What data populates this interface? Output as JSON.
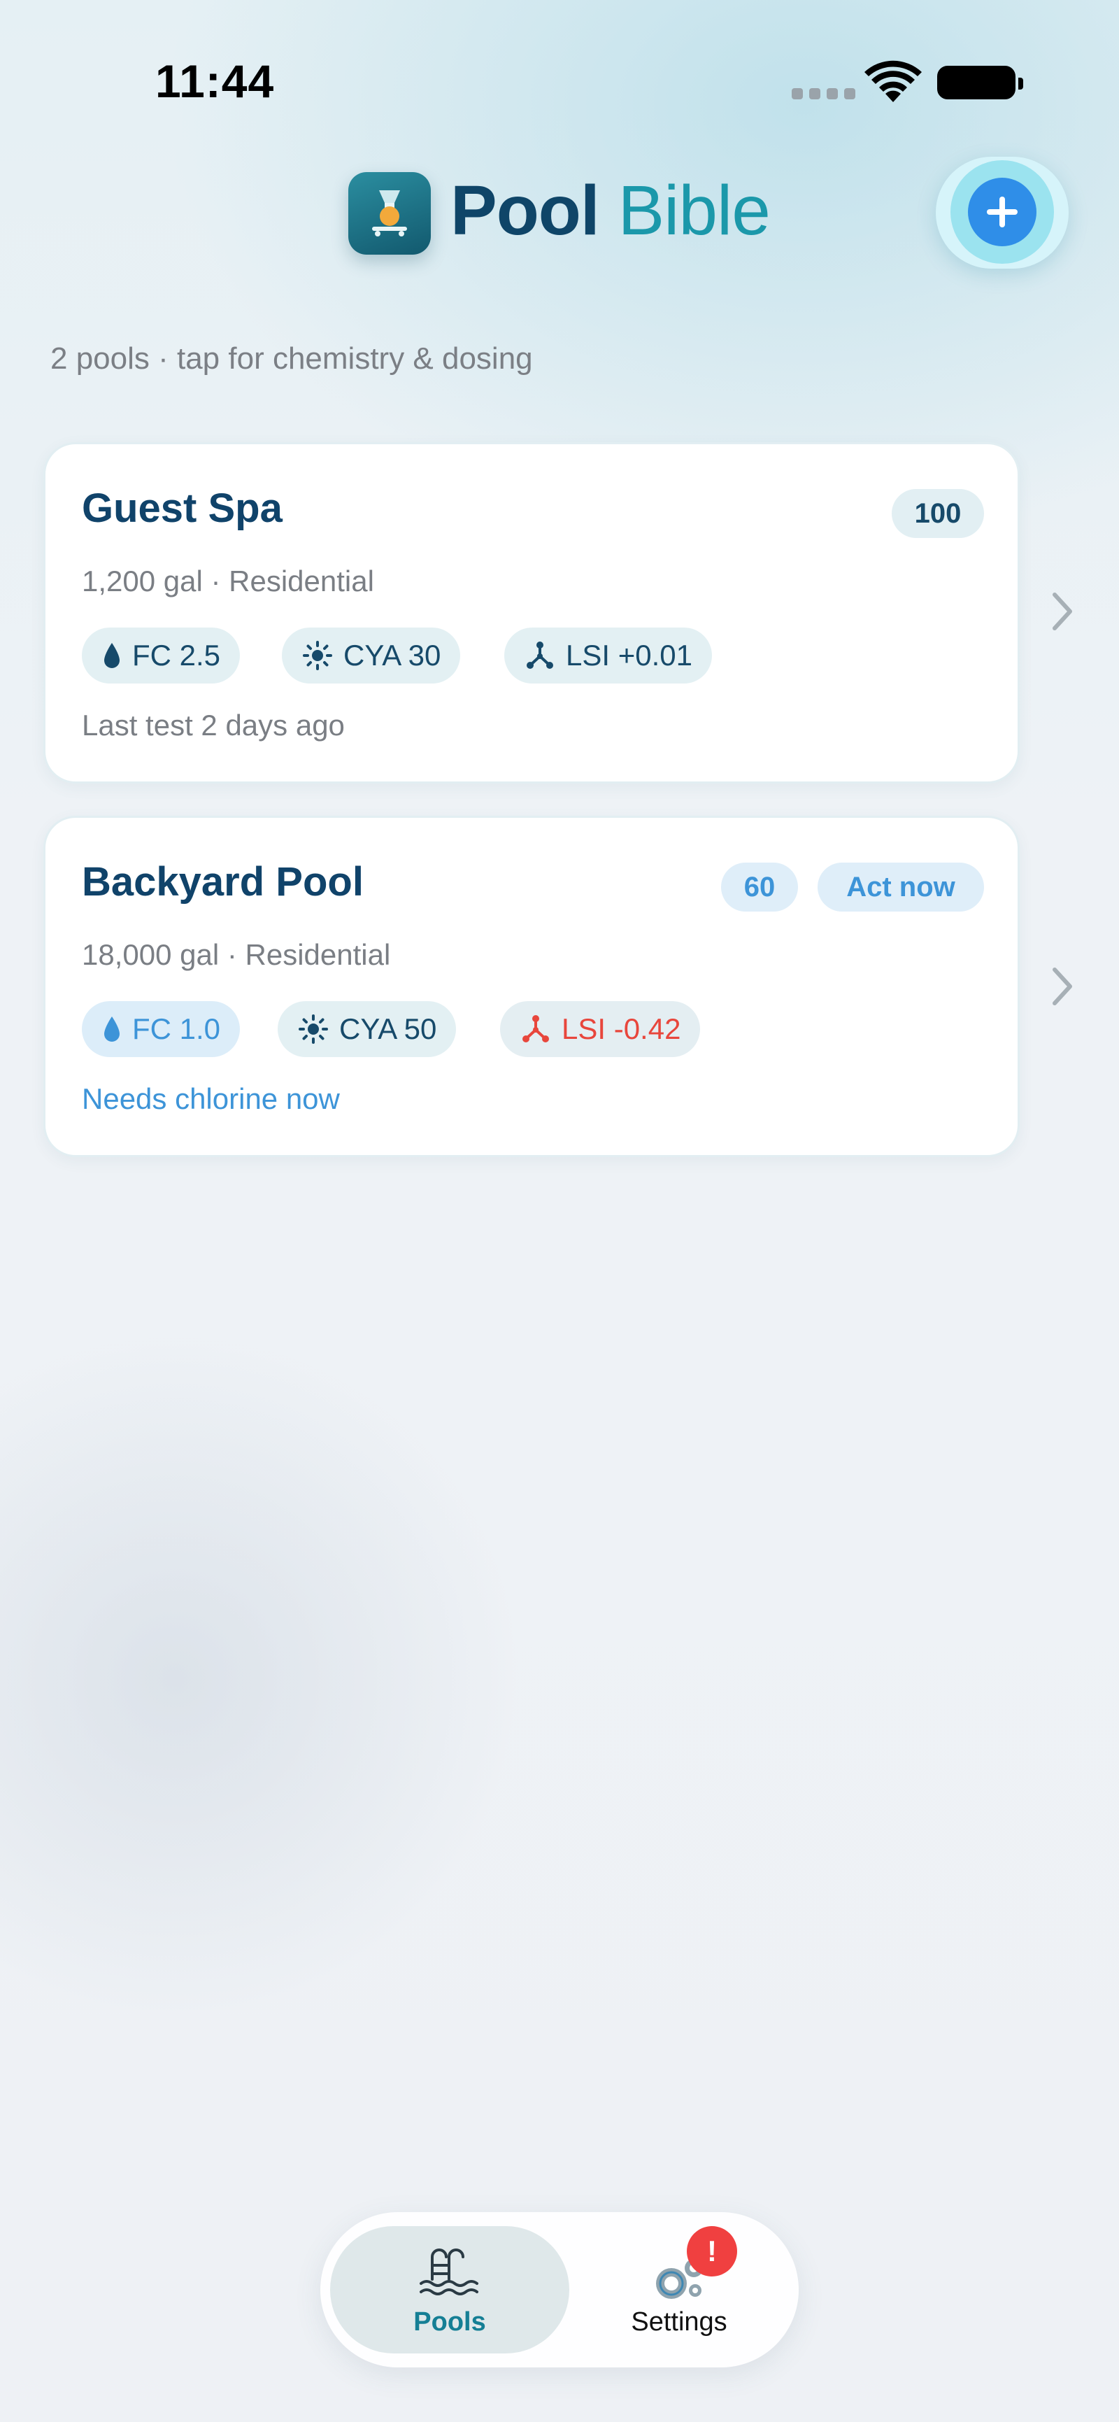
{
  "status_bar": {
    "time": "11:44"
  },
  "header": {
    "title_part1": "Pool",
    "title_part2": "Bible",
    "add_button_label": "+"
  },
  "subtitle": "2 pools · tap for chemistry & dosing",
  "pools": [
    {
      "name": "Guest Spa",
      "meta": "1,200 gal · Residential",
      "score": "100",
      "chips": [
        {
          "icon": "water-drop-icon",
          "text": "FC 2.5",
          "status": "normal"
        },
        {
          "icon": "sun-icon",
          "text": "CYA 30",
          "status": "normal"
        },
        {
          "icon": "balance-nodes-icon",
          "text": "LSI +0.01",
          "status": "normal"
        }
      ],
      "note": "Last test 2 days ago"
    },
    {
      "name": "Backyard Pool",
      "meta": "18,000 gal · Residential",
      "score": "60",
      "action_badge": "Act now",
      "chips": [
        {
          "icon": "water-drop-icon",
          "text": "FC 1.0",
          "status": "warning"
        },
        {
          "icon": "sun-icon",
          "text": "CYA 50",
          "status": "normal"
        },
        {
          "icon": "balance-nodes-icon",
          "text": "LSI -0.42",
          "status": "alert"
        }
      ],
      "note": "Needs chlorine now"
    }
  ],
  "tab_bar": {
    "tabs": [
      {
        "label": "Pools",
        "icon": "pool-ladder-icon",
        "active": true
      },
      {
        "label": "Settings",
        "icon": "gears-icon",
        "active": false,
        "badge": "!"
      }
    ]
  },
  "colors": {
    "brand_dark": "#0f4568",
    "brand_teal": "#1b98aa",
    "accent_blue": "#2f8ee8",
    "warning_blue": "#3d94d8",
    "alert_red": "#e8463c",
    "badge_red": "#f04040"
  }
}
